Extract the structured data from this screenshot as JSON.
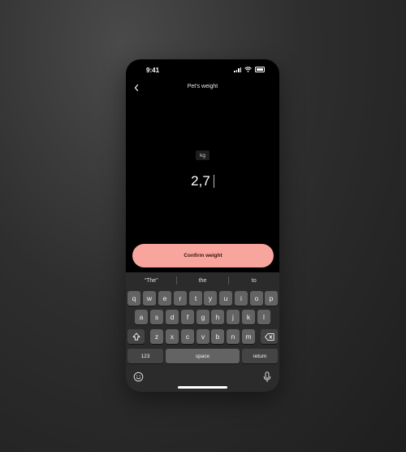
{
  "status": {
    "time": "9:41"
  },
  "nav": {
    "title": "Pet's weight"
  },
  "unit": "kg",
  "weight": {
    "value": "2,7"
  },
  "confirm": {
    "label": "Confirm weight"
  },
  "keyboard": {
    "suggestions": [
      "“The”",
      "the",
      "to"
    ],
    "row1": [
      "q",
      "w",
      "e",
      "r",
      "t",
      "y",
      "u",
      "i",
      "o",
      "p"
    ],
    "row2": [
      "a",
      "s",
      "d",
      "f",
      "g",
      "h",
      "j",
      "k",
      "l"
    ],
    "row3": [
      "z",
      "x",
      "c",
      "v",
      "b",
      "n",
      "m"
    ],
    "numbers_label": "123",
    "space_label": "space",
    "return_label": "return"
  }
}
